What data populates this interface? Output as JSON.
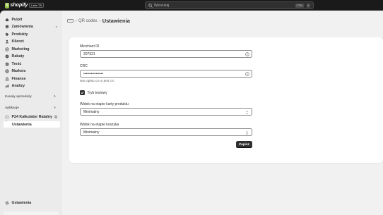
{
  "topbar": {
    "logo_mark": "S",
    "logo_text": "shopify",
    "plan_badge": "Labs '25",
    "search_placeholder": "Wyszukaj",
    "shortcut_ctrl": "CTRL",
    "shortcut_k": "K"
  },
  "sidebar": {
    "items": [
      {
        "label": "Pulpit",
        "icon": "home-icon"
      },
      {
        "label": "Zamówienia",
        "icon": "orders-icon",
        "count": "7"
      },
      {
        "label": "Produkty",
        "icon": "tag-icon"
      },
      {
        "label": "Klienci",
        "icon": "person-icon"
      },
      {
        "label": "Marketing",
        "icon": "target-icon"
      },
      {
        "label": "Rabaty",
        "icon": "discount-icon"
      },
      {
        "label": "Treść",
        "icon": "content-icon"
      },
      {
        "label": "Markets",
        "icon": "globe-icon"
      },
      {
        "label": "Finanse",
        "icon": "bank-icon"
      },
      {
        "label": "Analizy",
        "icon": "chart-icon"
      }
    ],
    "sales_channels_label": "Kanały sprzedaży",
    "apps_label": "Aplikacje",
    "app_name": "P24 Kalkulator Ratalny",
    "app_sub_item": "Ustawienia",
    "settings_label": "Ustawienia"
  },
  "breadcrumb": {
    "icon_text": "···",
    "parent": "QR codes",
    "current": "Ustawienia"
  },
  "form": {
    "merchant_id_label": "Merchant ID",
    "merchant_id_value": "207521",
    "crc_label": "CRC",
    "crc_value": "••••••••••••••••",
    "crc_help": "test opisu co to jest crc",
    "test_mode_label": "Tryb testowy",
    "product_widget_label": "Widok na etapie karty produktu",
    "product_widget_value": "Minimalny",
    "cart_widget_label": "Widok na etapie koszyka",
    "cart_widget_value": "Minimalny",
    "save_label": "Zapisz"
  },
  "colors": {
    "brand": "#95bf47",
    "topbar": "#1a1a1a",
    "primary_button": "#303030"
  }
}
